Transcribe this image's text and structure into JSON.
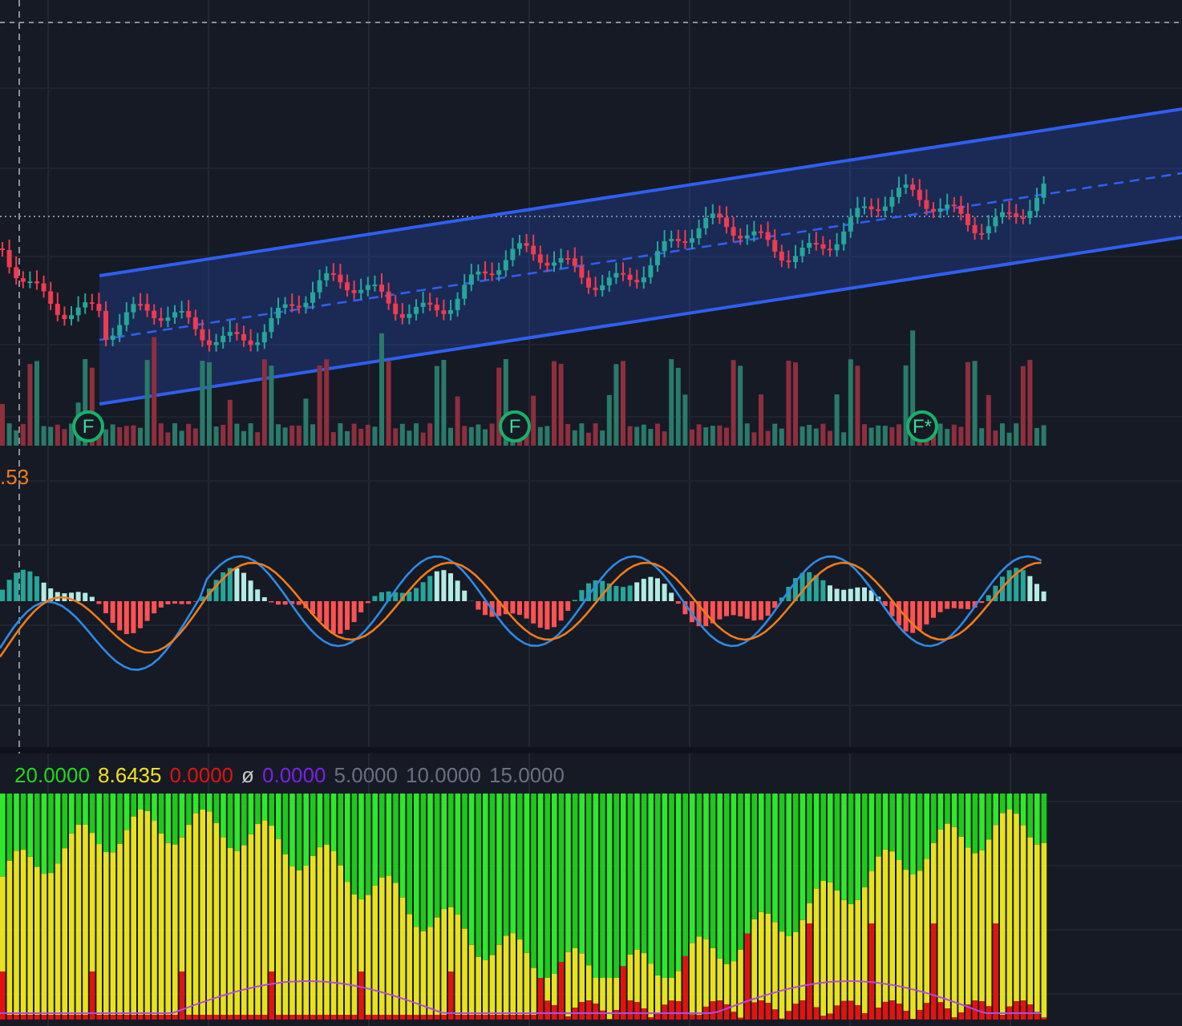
{
  "price_pane": {
    "markers": [
      {
        "label": "F"
      },
      {
        "label": "F"
      },
      {
        "label": "F*"
      }
    ]
  },
  "macd_pane": {
    "price_label": ".53"
  },
  "indicator_pane": {
    "legend": [
      {
        "text": "20.0000",
        "color": "#22d61e"
      },
      {
        "text": "8.6435",
        "color": "#f2e21b"
      },
      {
        "text": "0.0000",
        "color": "#e0140f"
      },
      {
        "text": "ø",
        "color": "#c8c8c8"
      },
      {
        "text": "0.0000",
        "color": "#7a22e6"
      },
      {
        "text": "5.0000",
        "color": "#6b7080"
      },
      {
        "text": "10.0000",
        "color": "#6b7080"
      },
      {
        "text": "15.0000",
        "color": "#6b7080"
      }
    ]
  }
}
